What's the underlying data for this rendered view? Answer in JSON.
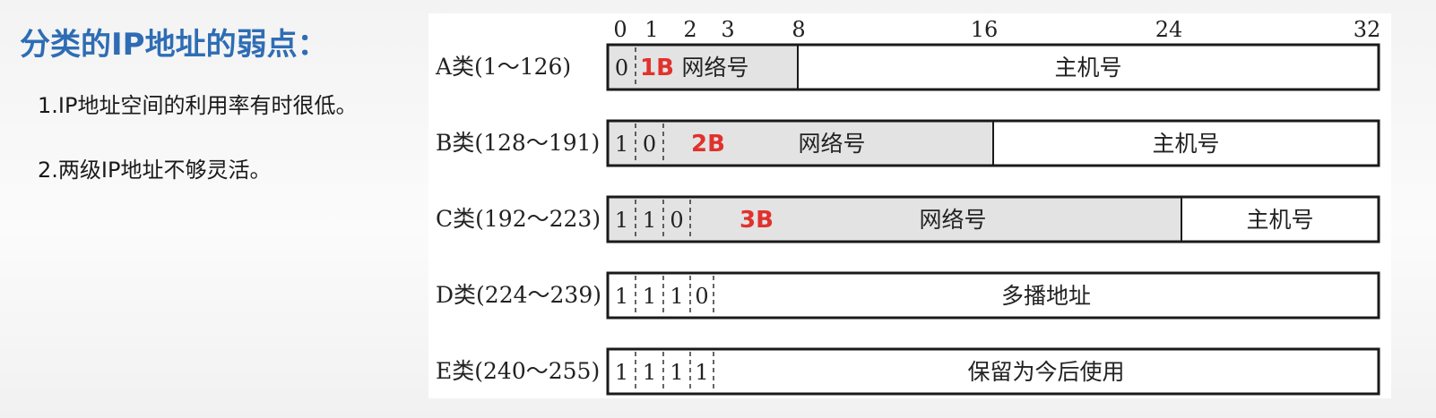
{
  "title": "分类的IP地址的弱点：",
  "points": [
    "1.IP地址空间的利用率有时很低。",
    "2.两级IP地址不够灵活。"
  ],
  "bit_positions": [
    "0",
    "1",
    "2",
    "3",
    "8",
    "16",
    "24",
    "32"
  ],
  "classes": [
    {
      "label": "A类(1～126)",
      "prefix": [
        "0"
      ],
      "net_bits": 8,
      "size_mark": "1B",
      "net_label": "网络号",
      "host_label": "主机号"
    },
    {
      "label": "B类(128～191)",
      "prefix": [
        "1",
        "0"
      ],
      "net_bits": 16,
      "size_mark": "2B",
      "net_label": "网络号",
      "host_label": "主机号"
    },
    {
      "label": "C类(192～223)",
      "prefix": [
        "1",
        "1",
        "0"
      ],
      "net_bits": 24,
      "size_mark": "3B",
      "net_label": "网络号",
      "host_label": "主机号"
    },
    {
      "label": "D类(224～239)",
      "prefix": [
        "1",
        "1",
        "1",
        "0"
      ],
      "net_bits": 0,
      "size_mark": "",
      "net_label": "",
      "host_label": "多播地址"
    },
    {
      "label": "E类(240～255)",
      "prefix": [
        "1",
        "1",
        "1",
        "1"
      ],
      "net_bits": 0,
      "size_mark": "",
      "net_label": "",
      "host_label": "保留为今后使用"
    }
  ],
  "colors": {
    "title": "#2e6db4",
    "mark": "#e0322d",
    "net_fill": "#e3e3e3",
    "line": "#1a1a1a"
  }
}
